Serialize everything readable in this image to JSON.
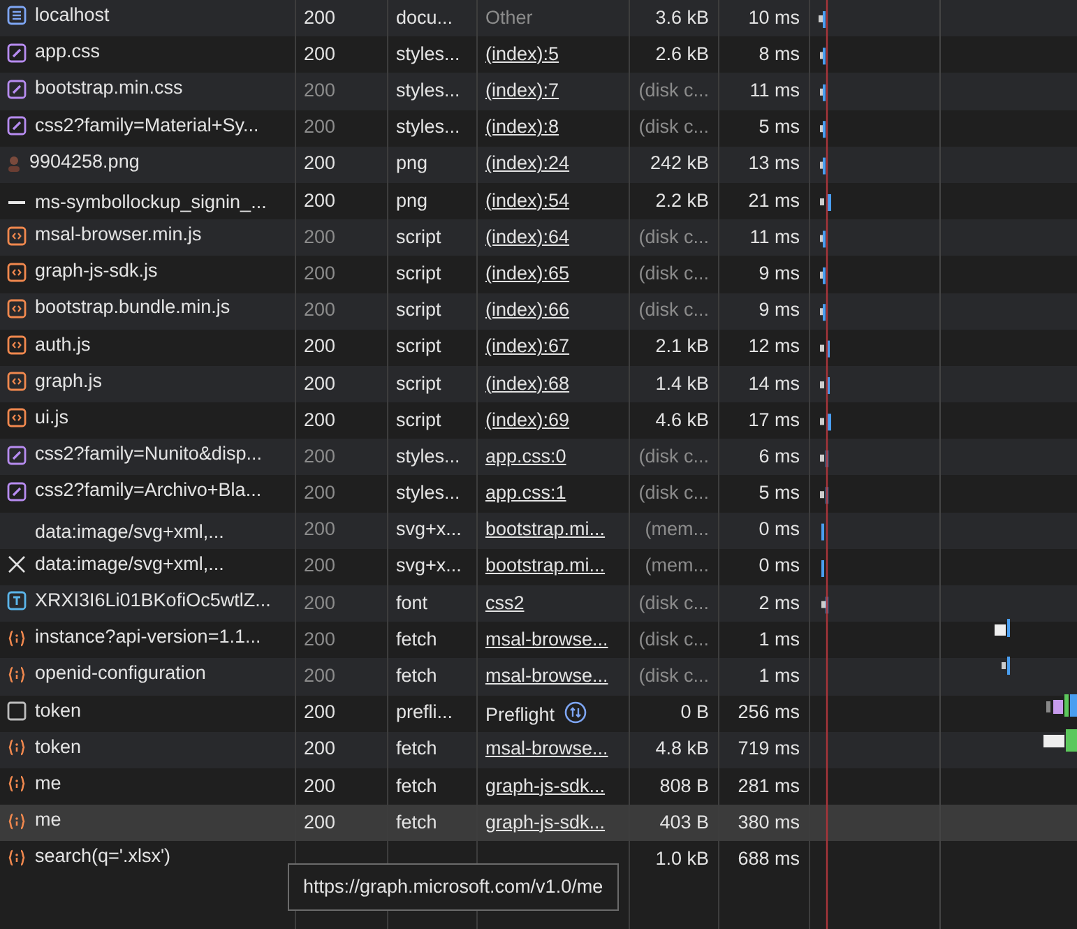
{
  "requests": [
    {
      "name": "localhost",
      "kind": "document",
      "status": "200",
      "type": "docu...",
      "initiator": "Other",
      "linked": false,
      "size": "3.6 kB",
      "time": "10 ms",
      "cached": false,
      "selected": false
    },
    {
      "name": "app.css",
      "kind": "stylesheet",
      "status": "200",
      "type": "styles...",
      "initiator": "(index):5",
      "linked": true,
      "size": "2.6 kB",
      "time": "8 ms",
      "cached": false,
      "selected": false
    },
    {
      "name": "bootstrap.min.css",
      "kind": "stylesheet",
      "status": "200",
      "type": "styles...",
      "initiator": "(index):7",
      "linked": true,
      "size": "(disk c...",
      "time": "11 ms",
      "cached": true,
      "selected": false
    },
    {
      "name": "css2?family=Material+Sy...",
      "kind": "stylesheet",
      "status": "200",
      "type": "styles...",
      "initiator": "(index):8",
      "linked": true,
      "size": "(disk c...",
      "time": "5 ms",
      "cached": true,
      "selected": false
    },
    {
      "name": "9904258.png",
      "kind": "image",
      "status": "200",
      "type": "png",
      "initiator": "(index):24",
      "linked": true,
      "size": "242 kB",
      "time": "13 ms",
      "cached": false,
      "selected": false
    },
    {
      "name": "ms-symbollockup_signin_...",
      "kind": "dash",
      "status": "200",
      "type": "png",
      "initiator": "(index):54",
      "linked": true,
      "size": "2.2 kB",
      "time": "21 ms",
      "cached": false,
      "selected": false
    },
    {
      "name": "msal-browser.min.js",
      "kind": "script",
      "status": "200",
      "type": "script",
      "initiator": "(index):64",
      "linked": true,
      "size": "(disk c...",
      "time": "11 ms",
      "cached": true,
      "selected": false
    },
    {
      "name": "graph-js-sdk.js",
      "kind": "script",
      "status": "200",
      "type": "script",
      "initiator": "(index):65",
      "linked": true,
      "size": "(disk c...",
      "time": "9 ms",
      "cached": true,
      "selected": false
    },
    {
      "name": "bootstrap.bundle.min.js",
      "kind": "script",
      "status": "200",
      "type": "script",
      "initiator": "(index):66",
      "linked": true,
      "size": "(disk c...",
      "time": "9 ms",
      "cached": true,
      "selected": false
    },
    {
      "name": "auth.js",
      "kind": "script",
      "status": "200",
      "type": "script",
      "initiator": "(index):67",
      "linked": true,
      "size": "2.1 kB",
      "time": "12 ms",
      "cached": false,
      "selected": false
    },
    {
      "name": "graph.js",
      "kind": "script",
      "status": "200",
      "type": "script",
      "initiator": "(index):68",
      "linked": true,
      "size": "1.4 kB",
      "time": "14 ms",
      "cached": false,
      "selected": false
    },
    {
      "name": "ui.js",
      "kind": "script",
      "status": "200",
      "type": "script",
      "initiator": "(index):69",
      "linked": true,
      "size": "4.6 kB",
      "time": "17 ms",
      "cached": false,
      "selected": false
    },
    {
      "name": "css2?family=Nunito&disp...",
      "kind": "stylesheet",
      "status": "200",
      "type": "styles...",
      "initiator": "app.css:0",
      "linked": true,
      "size": "(disk c...",
      "time": "6 ms",
      "cached": true,
      "selected": false
    },
    {
      "name": "css2?family=Archivo+Bla...",
      "kind": "stylesheet",
      "status": "200",
      "type": "styles...",
      "initiator": "app.css:1",
      "linked": true,
      "size": "(disk c...",
      "time": "5 ms",
      "cached": true,
      "selected": false
    },
    {
      "name": "data:image/svg+xml,...",
      "kind": "blank",
      "status": "200",
      "type": "svg+x...",
      "initiator": "bootstrap.mi...",
      "linked": true,
      "size": "(mem...",
      "time": "0 ms",
      "cached": true,
      "selected": false
    },
    {
      "name": "data:image/svg+xml,...",
      "kind": "cross",
      "status": "200",
      "type": "svg+x...",
      "initiator": "bootstrap.mi...",
      "linked": true,
      "size": "(mem...",
      "time": "0 ms",
      "cached": true,
      "selected": false
    },
    {
      "name": "XRXI3I6Li01BKofiOc5wtlZ...",
      "kind": "font",
      "status": "200",
      "type": "font",
      "initiator": "css2",
      "linked": true,
      "size": "(disk c...",
      "time": "2 ms",
      "cached": true,
      "selected": false
    },
    {
      "name": "instance?api-version=1.1...",
      "kind": "fetch",
      "status": "200",
      "type": "fetch",
      "initiator": "msal-browse...",
      "linked": true,
      "size": "(disk c...",
      "time": "1 ms",
      "cached": true,
      "selected": false
    },
    {
      "name": "openid-configuration",
      "kind": "fetch",
      "status": "200",
      "type": "fetch",
      "initiator": "msal-browse...",
      "linked": true,
      "size": "(disk c...",
      "time": "1 ms",
      "cached": true,
      "selected": false
    },
    {
      "name": "token",
      "kind": "preflight",
      "status": "200",
      "type": "prefli...",
      "initiator": "Preflight",
      "linked": false,
      "size": "0 B",
      "time": "256 ms",
      "cached": false,
      "selected": false
    },
    {
      "name": "token",
      "kind": "fetch",
      "status": "200",
      "type": "fetch",
      "initiator": "msal-browse...",
      "linked": true,
      "size": "4.8 kB",
      "time": "719 ms",
      "cached": false,
      "selected": false
    },
    {
      "name": "me",
      "kind": "fetch",
      "status": "200",
      "type": "fetch",
      "initiator": "graph-js-sdk...",
      "linked": true,
      "size": "808 B",
      "time": "281 ms",
      "cached": false,
      "selected": false
    },
    {
      "name": "me",
      "kind": "fetch",
      "status": "200",
      "type": "fetch",
      "initiator": "graph-js-sdk...",
      "linked": true,
      "size": "403 B",
      "time": "380 ms",
      "cached": false,
      "selected": true
    },
    {
      "name": "search(q='.xlsx')",
      "kind": "fetch",
      "size": "1.0 kB",
      "time": "688 ms",
      "cached": false,
      "selected": false
    }
  ],
  "tooltip": "https://graph.microsoft.com/v1.0/me"
}
